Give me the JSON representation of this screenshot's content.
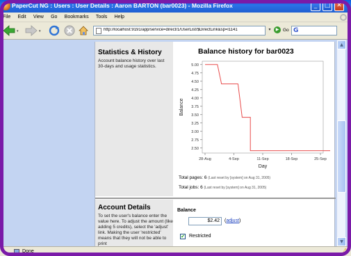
{
  "window": {
    "title": "PaperCut NG : Users : User Details : Aaron BARTON (bar0023) - Mozilla Firefox",
    "min_glyph": "_",
    "max_glyph": "□",
    "close_glyph": "✕"
  },
  "menu": [
    "File",
    "Edit",
    "View",
    "Go",
    "Bookmarks",
    "Tools",
    "Help"
  ],
  "nav": {
    "url": "http://localhost:9191/app/service=direct/1/UserList/$DirectLink&sp=l1141",
    "go_label": "Go",
    "go_glyph": "▶",
    "dropdown_glyph": "▾",
    "search_glyph": "G",
    "icons": [
      "back-icon",
      "forward-icon",
      "reload-icon",
      "stop-icon",
      "home-icon",
      "page-icon",
      "go-icon",
      "google-icon"
    ]
  },
  "stats": {
    "title": "Statistics & History",
    "description": "Account balance history over last 30-days and usage statistics.",
    "chart_title": "Balance history for bar0023",
    "total_pages_label": "Total pages: 6",
    "total_pages_note": "(Last reset by [system] on Aug 31, 2005)",
    "total_jobs_label": "Total jobs: 6",
    "total_jobs_note": "(Last reset by [system] on Aug 31, 2005)"
  },
  "account": {
    "title": "Account Details",
    "description": "To set the user's balance enter the value here. To adjust the amount (like adding 5 credits), select the 'adjust' link. Making the user 'restricted' means that they will not be able to print",
    "balance_label": "Balance",
    "balance_value": "$2.42",
    "adjust_label": "adjust",
    "restricted_label": "Restricted",
    "restricted_checked": true,
    "check_glyph": "✔"
  },
  "status": {
    "text": "Done",
    "warn_glyph": "⚠"
  },
  "scrollbar": {
    "up_glyph": "▲",
    "down_glyph": "▼"
  },
  "chart_data": {
    "type": "line",
    "title": "Balance history for bar0023",
    "xlabel": "Day",
    "ylabel": "Balance",
    "x_ticks": [
      "28-Aug",
      "4-Sep",
      "11-Sep",
      "18-Sep",
      "25-Sep"
    ],
    "y_ticks": [
      "2.50",
      "2.75",
      "3.00",
      "3.25",
      "3.50",
      "3.75",
      "4.00",
      "4.25",
      "4.50",
      "4.75",
      "5.00"
    ],
    "ylim": [
      2.35,
      5.1
    ],
    "x": [
      "28-Aug",
      "31-Aug",
      "1-Sep",
      "3-Sep",
      "5-Sep",
      "6-Sep",
      "7-Sep",
      "8-Sep",
      "8-Sep",
      "28-Sep"
    ],
    "values": [
      5.0,
      5.0,
      4.42,
      4.42,
      4.42,
      3.42,
      3.42,
      3.42,
      2.42,
      2.42
    ],
    "series_color": "#e84c4c",
    "grid": false,
    "legend": "none"
  }
}
